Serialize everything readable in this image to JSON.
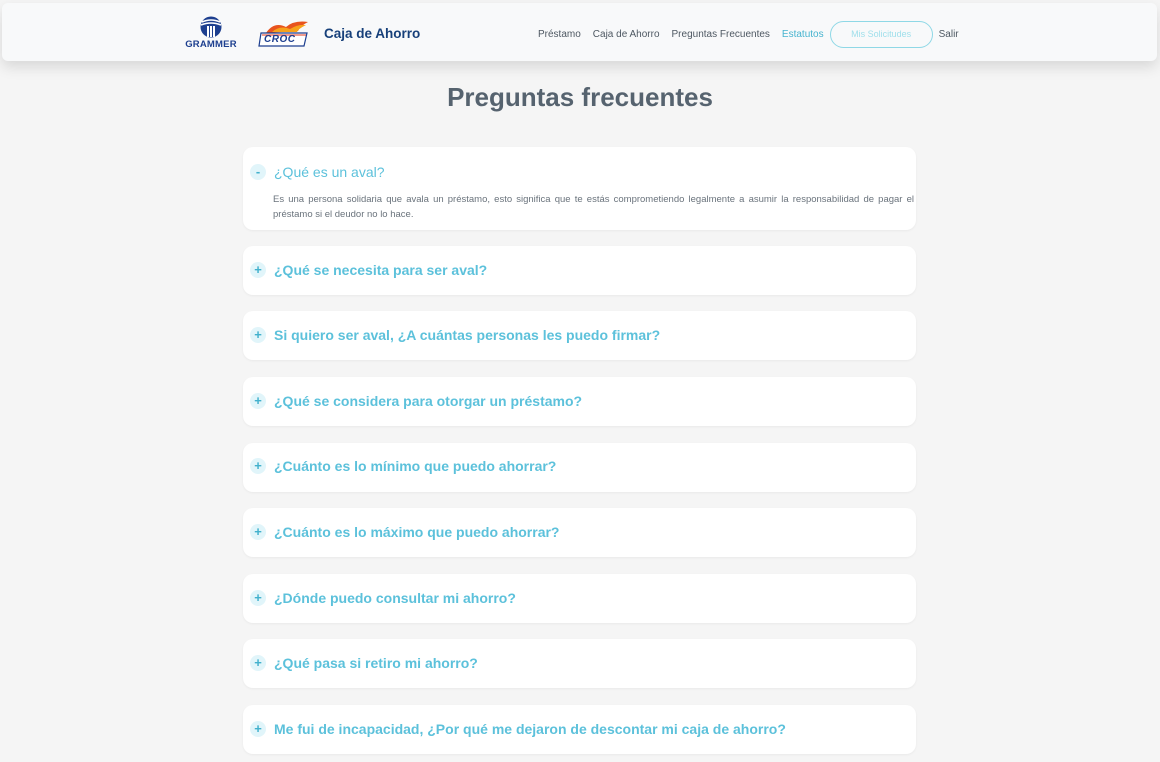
{
  "header": {
    "grammer_logo": "GRAMMER",
    "croc_logo": "CROC",
    "title": "Caja de Ahorro",
    "nav": [
      {
        "label": "Préstamo"
      },
      {
        "label": "Caja de Ahorro"
      },
      {
        "label": "Preguntas Frecuentes"
      },
      {
        "label": "Estatutos"
      }
    ],
    "my_requests_label": "Mis Solicitudes",
    "logout_label": "Salir",
    "colors": {
      "accent": "#47b4cf",
      "brand": "#17407a"
    }
  },
  "page": {
    "title": "Preguntas frecuentes"
  },
  "faq": [
    {
      "toggle": "-",
      "question": "¿Qué es un aval?",
      "answer": "Es una persona solidaria que avala un préstamo, esto significa que te estás comprometiendo legalmente a asumir la responsabilidad de pagar el préstamo si el deudor no lo hace.",
      "expanded": true
    },
    {
      "toggle": "+",
      "question": "¿Qué se necesita para ser aval?",
      "expanded": false
    },
    {
      "toggle": "+",
      "question": "Si quiero ser aval, ¿A cuántas personas les puedo firmar?",
      "expanded": false
    },
    {
      "toggle": "+",
      "question": "¿Qué se considera para otorgar un préstamo?",
      "expanded": false
    },
    {
      "toggle": "+",
      "question": "¿Cuánto es lo mínimo que puedo ahorrar?",
      "expanded": false
    },
    {
      "toggle": "+",
      "question": "¿Cuánto es lo máximo que puedo ahorrar?",
      "expanded": false
    },
    {
      "toggle": "+",
      "question": "¿Dónde puedo consultar mi ahorro?",
      "expanded": false
    },
    {
      "toggle": "+",
      "question": "¿Qué pasa si retiro mi ahorro?",
      "expanded": false
    },
    {
      "toggle": "+",
      "question": "Me fui de incapacidad, ¿Por qué me dejaron de descontar mi caja de ahorro?",
      "expanded": false
    }
  ]
}
